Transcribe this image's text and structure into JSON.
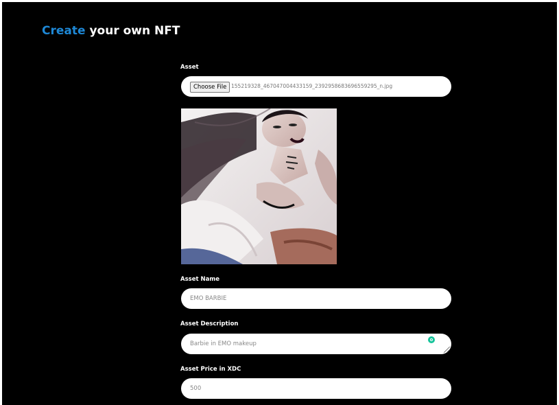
{
  "header": {
    "title_accent": "Create",
    "title_rest": "your own NFT"
  },
  "asset": {
    "label": "Asset",
    "choose_button": "Choose File",
    "file_name": "155219328_467047004433159_2392958683696559295_n.jpg"
  },
  "name": {
    "label": "Asset Name",
    "value": "EMO BARBIE"
  },
  "description": {
    "label": "Asset Description",
    "value": "Barbie in EMO makeup"
  },
  "price": {
    "label": "Asset Price in XDC",
    "value": "500"
  },
  "colors": {
    "accent": "#1e88d6",
    "background": "#000000"
  }
}
